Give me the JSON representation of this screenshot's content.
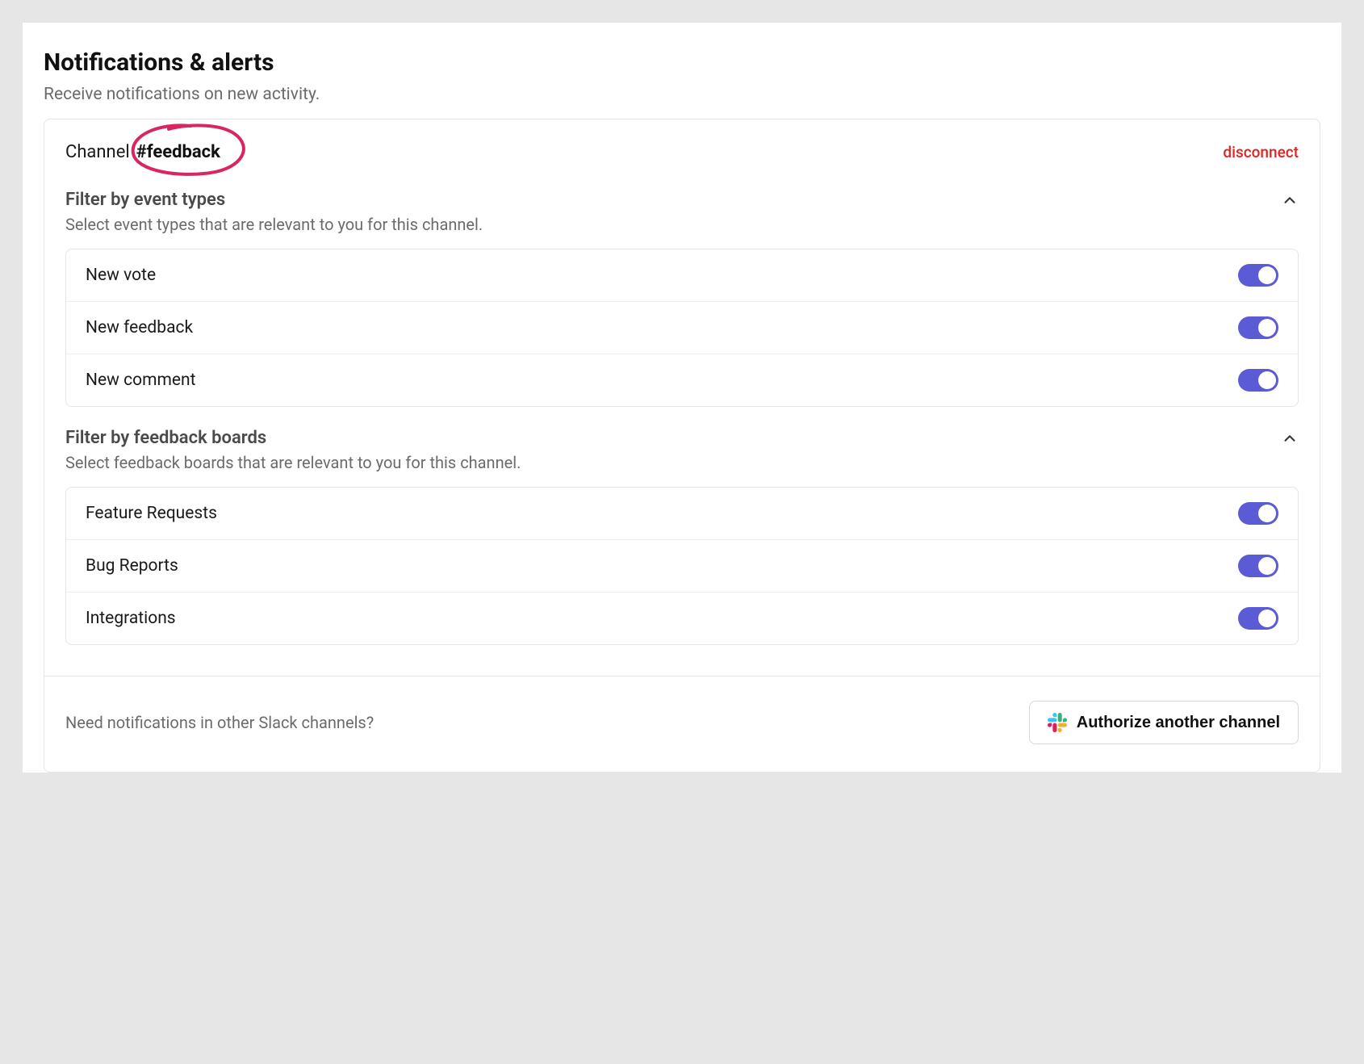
{
  "header": {
    "title": "Notifications & alerts",
    "subtitle": "Receive notifications on new activity."
  },
  "channel": {
    "label": "Channel",
    "name": "#feedback",
    "disconnect_label": "disconnect",
    "annotation_color": "#d72660"
  },
  "sections": {
    "event_types": {
      "title": "Filter by event types",
      "description": "Select event types that are relevant to you for this channel.",
      "items": [
        {
          "label": "New vote",
          "on": true
        },
        {
          "label": "New feedback",
          "on": true
        },
        {
          "label": "New comment",
          "on": true
        }
      ]
    },
    "boards": {
      "title": "Filter by feedback boards",
      "description": "Select feedback boards that are relevant to you for this channel.",
      "items": [
        {
          "label": "Feature Requests",
          "on": true
        },
        {
          "label": "Bug Reports",
          "on": true
        },
        {
          "label": "Integrations",
          "on": true
        }
      ]
    }
  },
  "footer": {
    "text": "Need notifications in other Slack channels?",
    "button_label": "Authorize another channel"
  },
  "colors": {
    "toggle_on": "#5b5bd6",
    "danger": "#e02424"
  }
}
